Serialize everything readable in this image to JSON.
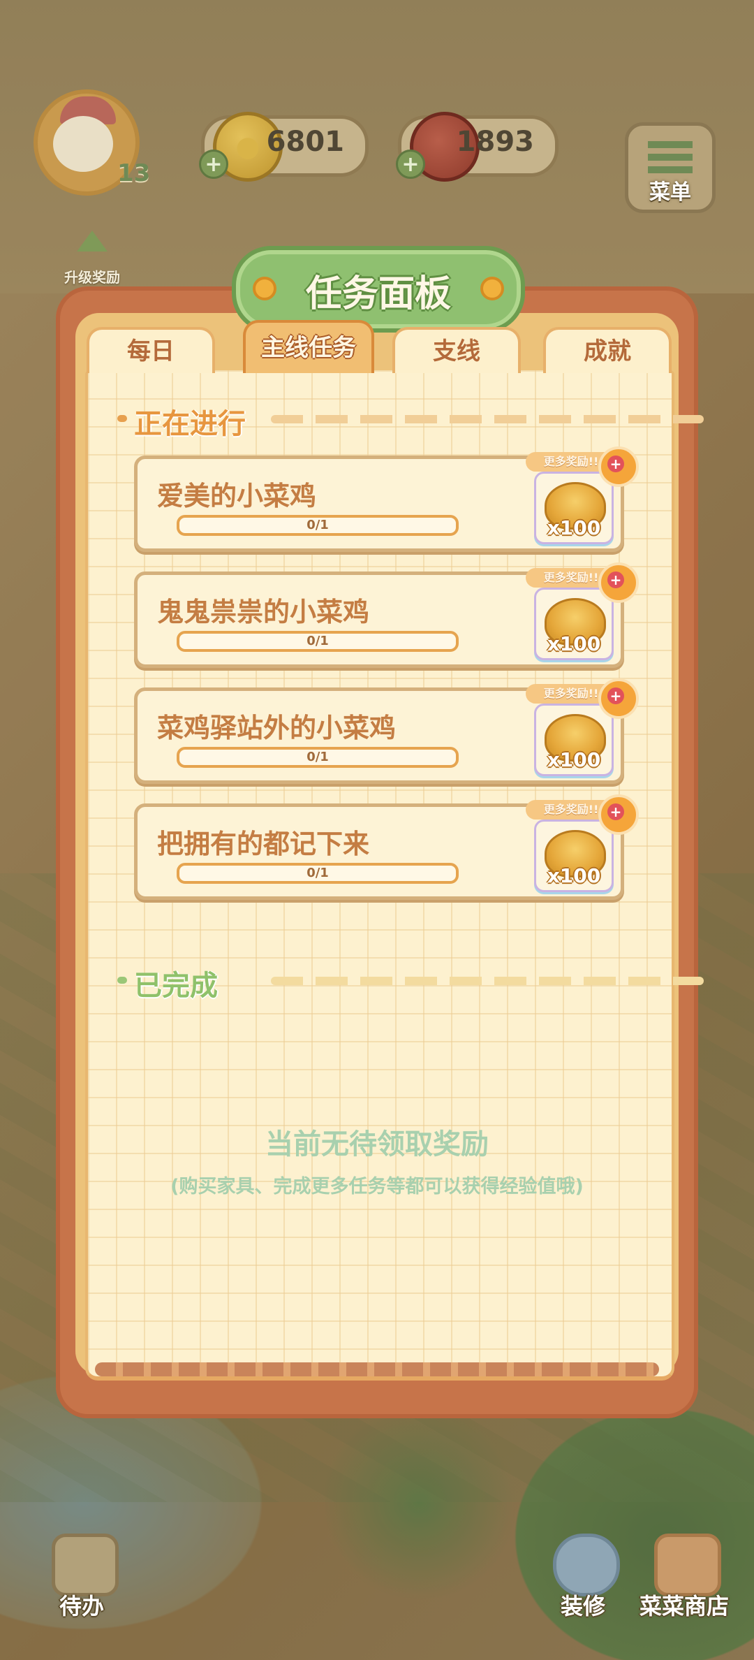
{
  "hud": {
    "level": "13",
    "coins": "6801",
    "meat": "1893",
    "menu_label": "菜单",
    "upgrade_label": "升级奖励"
  },
  "panel": {
    "title": "任务面板",
    "tabs": [
      {
        "label": "每日",
        "active": false
      },
      {
        "label": "主线任务",
        "active": true
      },
      {
        "label": "支线",
        "active": false
      },
      {
        "label": "成就",
        "active": false
      }
    ],
    "ongoing_label": "正在进行",
    "completed_label": "已完成",
    "tasks": [
      {
        "title": "爱美的小菜鸡",
        "progress": "0/1",
        "progress_fraction": 0,
        "more_rewards": "更多奖励!!",
        "reward_amount": "x100"
      },
      {
        "title": "鬼鬼祟祟的小菜鸡",
        "progress": "0/1",
        "progress_fraction": 0,
        "more_rewards": "更多奖励!!",
        "reward_amount": "x100"
      },
      {
        "title": "菜鸡驿站外的小菜鸡",
        "progress": "0/1",
        "progress_fraction": 0,
        "more_rewards": "更多奖励!!",
        "reward_amount": "x100"
      },
      {
        "title": "把拥有的都记下来",
        "progress": "0/1",
        "progress_fraction": 0,
        "more_rewards": "更多奖励!!",
        "reward_amount": "x100"
      }
    ],
    "empty_message": "当前无待领取奖励",
    "empty_hint": "(购买家具、完成更多任务等都可以获得经验值哦)"
  },
  "bottom_nav": {
    "todo": "待办",
    "decorate": "装修",
    "shop": "菜菜商店"
  },
  "colors": {
    "panel_frame": "#c7744a",
    "paper": "#fdf1cf",
    "title_banner": "#8fc070",
    "task_text": "#c47d43",
    "empty_text": "#a8d0ae"
  }
}
